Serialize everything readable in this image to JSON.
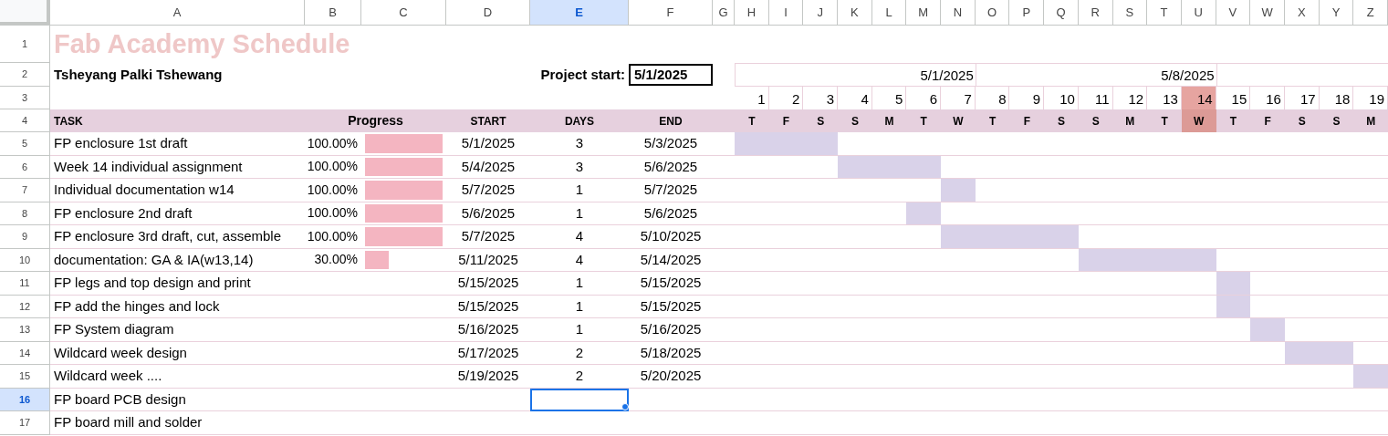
{
  "columns": [
    {
      "label": "A",
      "selected": false
    },
    {
      "label": "B",
      "selected": false
    },
    {
      "label": "C",
      "selected": false
    },
    {
      "label": "D",
      "selected": false
    },
    {
      "label": "E",
      "selected": true
    },
    {
      "label": "F",
      "selected": false
    },
    {
      "label": "G",
      "selected": false
    },
    {
      "label": "H",
      "selected": false
    },
    {
      "label": "I",
      "selected": false
    },
    {
      "label": "J",
      "selected": false
    },
    {
      "label": "K",
      "selected": false
    },
    {
      "label": "L",
      "selected": false
    },
    {
      "label": "M",
      "selected": false
    },
    {
      "label": "N",
      "selected": false
    },
    {
      "label": "O",
      "selected": false
    },
    {
      "label": "P",
      "selected": false
    },
    {
      "label": "Q",
      "selected": false
    },
    {
      "label": "R",
      "selected": false
    },
    {
      "label": "S",
      "selected": false
    },
    {
      "label": "T",
      "selected": false
    },
    {
      "label": "U",
      "selected": false
    },
    {
      "label": "V",
      "selected": false
    },
    {
      "label": "W",
      "selected": false
    },
    {
      "label": "X",
      "selected": false
    },
    {
      "label": "Y",
      "selected": false
    },
    {
      "label": "Z",
      "selected": false
    }
  ],
  "row_numbers": [
    {
      "label": "1",
      "selected": false
    },
    {
      "label": "2",
      "selected": false
    },
    {
      "label": "3",
      "selected": false
    },
    {
      "label": "4",
      "selected": false
    },
    {
      "label": "5",
      "selected": false
    },
    {
      "label": "6",
      "selected": false
    },
    {
      "label": "7",
      "selected": false
    },
    {
      "label": "8",
      "selected": false
    },
    {
      "label": "9",
      "selected": false
    },
    {
      "label": "10",
      "selected": false
    },
    {
      "label": "11",
      "selected": false
    },
    {
      "label": "12",
      "selected": false
    },
    {
      "label": "13",
      "selected": false
    },
    {
      "label": "14",
      "selected": false
    },
    {
      "label": "15",
      "selected": false
    },
    {
      "label": "16",
      "selected": true
    },
    {
      "label": "17",
      "selected": false
    }
  ],
  "title": "Fab Academy Schedule",
  "owner": "Tsheyang Palki Tshewang",
  "project_start": {
    "label": "Project start:",
    "value": "5/1/2025"
  },
  "weeks": [
    "5/1/2025",
    "5/8/2025"
  ],
  "days": [
    {
      "number": "1",
      "weekday": "T",
      "selected": false
    },
    {
      "number": "2",
      "weekday": "F",
      "selected": false
    },
    {
      "number": "3",
      "weekday": "S",
      "selected": false
    },
    {
      "number": "4",
      "weekday": "S",
      "selected": false
    },
    {
      "number": "5",
      "weekday": "M",
      "selected": false
    },
    {
      "number": "6",
      "weekday": "T",
      "selected": false
    },
    {
      "number": "7",
      "weekday": "W",
      "selected": false
    },
    {
      "number": "8",
      "weekday": "T",
      "selected": false
    },
    {
      "number": "9",
      "weekday": "F",
      "selected": false
    },
    {
      "number": "10",
      "weekday": "S",
      "selected": false
    },
    {
      "number": "11",
      "weekday": "S",
      "selected": false
    },
    {
      "number": "12",
      "weekday": "M",
      "selected": false
    },
    {
      "number": "13",
      "weekday": "T",
      "selected": false
    },
    {
      "number": "14",
      "weekday": "W",
      "selected": true
    },
    {
      "number": "15",
      "weekday": "T",
      "selected": false
    },
    {
      "number": "16",
      "weekday": "F",
      "selected": false
    },
    {
      "number": "17",
      "weekday": "S",
      "selected": false
    },
    {
      "number": "18",
      "weekday": "S",
      "selected": false
    },
    {
      "number": "19",
      "weekday": "M",
      "selected": false
    }
  ],
  "headers": {
    "task": "TASK",
    "progress": "Progress",
    "start": "START",
    "days": "DAYS",
    "end": "END"
  },
  "tasks": [
    {
      "name": "FP enclosure 1st draft",
      "progress": "100.00%",
      "level": 1,
      "start": "5/1/2025",
      "days": "3",
      "end": "5/3/2025"
    },
    {
      "name": "Week 14 individual assignment",
      "progress": "100.00%",
      "level": 1,
      "start": "5/4/2025",
      "days": "3",
      "end": "5/6/2025"
    },
    {
      "name": "Individual documentation w14",
      "progress": "100.00%",
      "level": 1,
      "start": "5/7/2025",
      "days": "1",
      "end": "5/7/2025"
    },
    {
      "name": "FP enclosure 2nd draft",
      "progress": "100.00%",
      "level": 1,
      "start": "5/6/2025",
      "days": "1",
      "end": "5/6/2025"
    },
    {
      "name": "FP enclosure 3rd draft, cut, assemble",
      "progress": "100.00%",
      "level": 1,
      "start": "5/7/2025",
      "days": "4",
      "end": "5/10/2025"
    },
    {
      "name": "documentation: GA & IA(w13,14)",
      "progress": "30.00%",
      "level": 0.3,
      "start": "5/11/2025",
      "days": "4",
      "end": "5/14/2025"
    },
    {
      "name": "FP legs and top design and print",
      "start": "5/15/2025",
      "days": "1",
      "end": "5/15/2025"
    },
    {
      "name": "FP add the hinges and lock",
      "start": "5/15/2025",
      "days": "1",
      "end": "5/15/2025"
    },
    {
      "name": "FP System diagram",
      "start": "5/16/2025",
      "days": "1",
      "end": "5/16/2025"
    },
    {
      "name": "Wildcard week design",
      "start": "5/17/2025",
      "days": "2",
      "end": "5/18/2025"
    },
    {
      "name": "Wildcard week ....",
      "start": "5/19/2025",
      "days": "2",
      "end": "5/20/2025"
    },
    {
      "name": "FP board PCB design"
    },
    {
      "name": "FP board mill and solder"
    }
  ]
}
